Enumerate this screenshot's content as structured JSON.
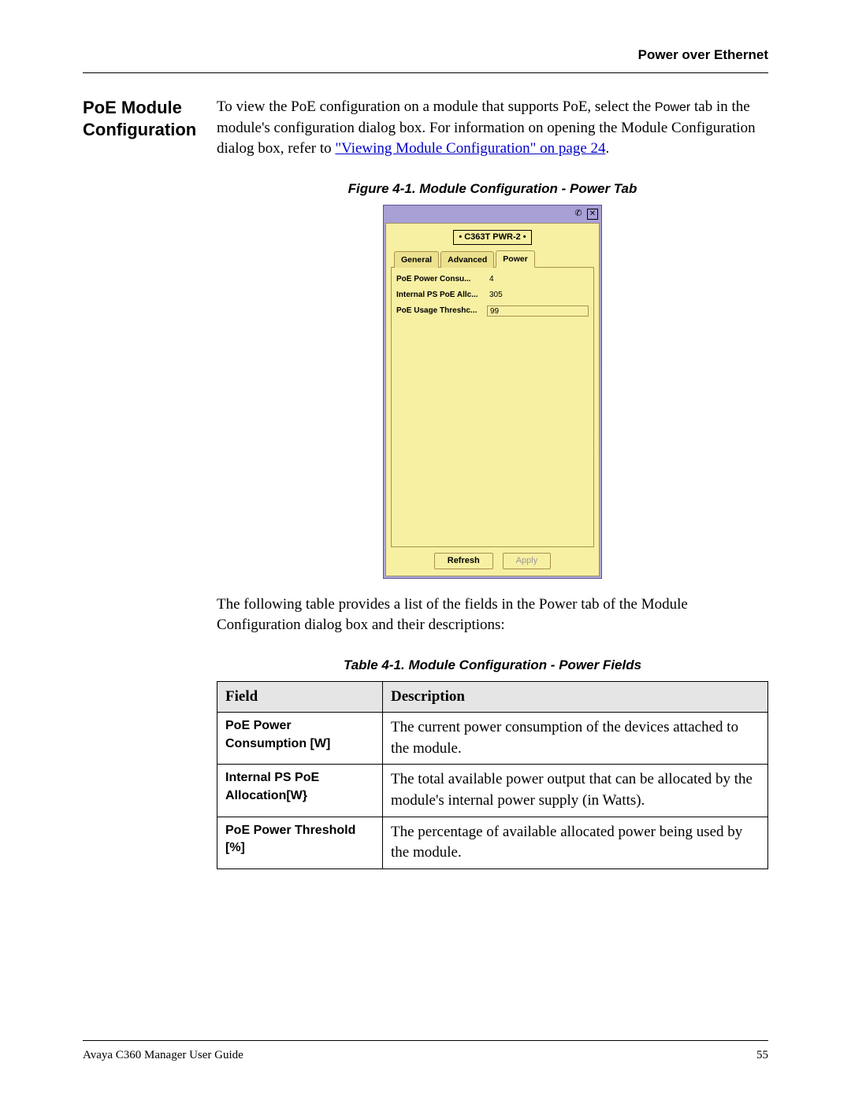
{
  "header": {
    "chapter_title": "Power over Ethernet"
  },
  "section": {
    "title": "PoE Module Configuration"
  },
  "paragraph1": {
    "pre_tab": "To view the PoE configuration on a module that supports PoE, select the ",
    "tab_word": "Power",
    "post_tab": " tab in the module's configuration dialog box. For information on opening the Module Configuration dialog box, refer to ",
    "link_text": "\"Viewing Module Configuration\" on page 24",
    "period": "."
  },
  "figure_caption": "Figure 4-1.  Module Configuration - Power Tab",
  "dialog": {
    "device_label": "• C363T PWR-2 •",
    "tabs": [
      "General",
      "Advanced",
      "Power"
    ],
    "active_tab_index": 2,
    "fields": [
      {
        "label": "PoE Power Consu...",
        "value": "4",
        "bordered": false
      },
      {
        "label": "Internal PS PoE Allc...",
        "value": "305",
        "bordered": false
      },
      {
        "label": "PoE Usage Threshc...",
        "value": "99",
        "bordered": true
      }
    ],
    "buttons": {
      "refresh": "Refresh",
      "apply": "Apply"
    }
  },
  "paragraph2": "The following table provides a list of the fields in the Power tab of the Module Configuration dialog box and their descriptions:",
  "table_caption": "Table 4-1.  Module Configuration - Power Fields",
  "table": {
    "headers": [
      "Field",
      "Description"
    ],
    "rows": [
      {
        "field": "PoE Power Consumption [W]",
        "desc": "The current power consumption of the devices attached to the module."
      },
      {
        "field": "Internal PS PoE Allocation[W}",
        "desc": "The total available power output that can be allocated by the module's internal power supply (in Watts)."
      },
      {
        "field": "PoE Power Threshold [%]",
        "desc": "The percentage of available allocated power being used by the module."
      }
    ]
  },
  "footer": {
    "left": "Avaya C360 Manager User Guide",
    "right": "55"
  }
}
